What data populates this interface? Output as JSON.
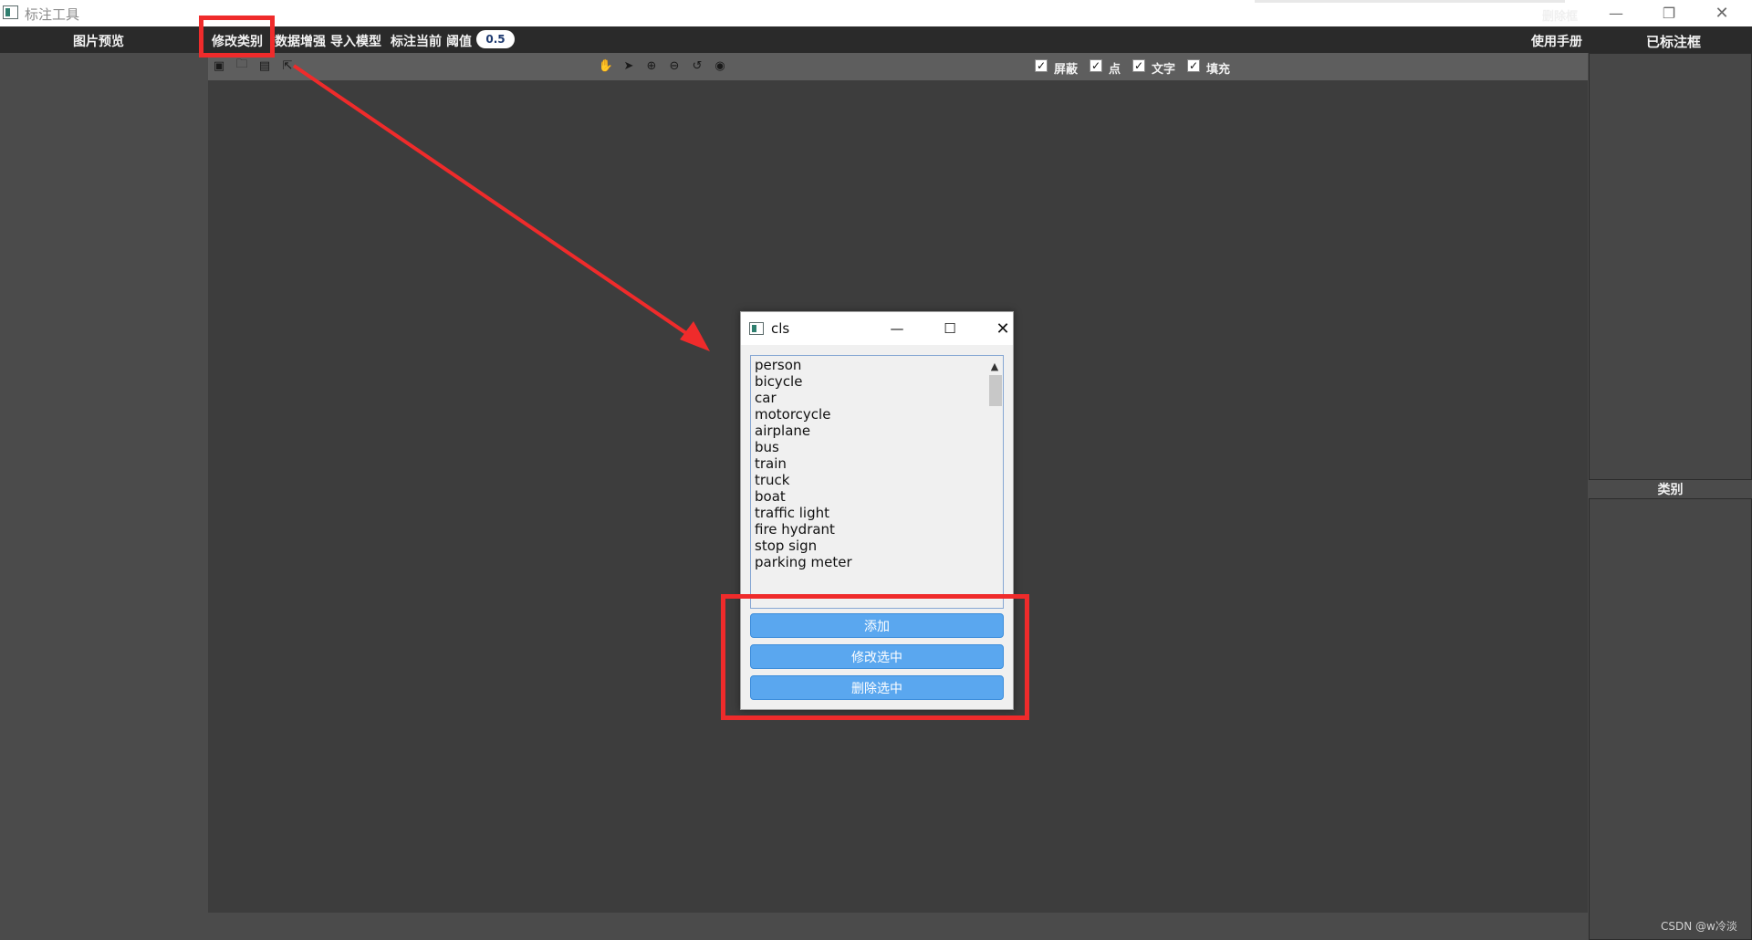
{
  "window": {
    "title": "标注工具",
    "controls": {
      "minimize": "—",
      "maximize": "❐",
      "close": "✕"
    }
  },
  "menubar": {
    "preview": "图片预览",
    "modify_class": "修改类别",
    "augment": "数据增强",
    "import_model": "导入模型",
    "annotate_current": "标注当前",
    "threshold_label": "阈值",
    "threshold_value": "0.5",
    "manual": "使用手册",
    "annotated_boxes": "已标注框"
  },
  "toolbar": {
    "left_icons": [
      "image-icon",
      "folder-icon",
      "save-icon",
      "export-icon"
    ],
    "center_icons": [
      "hand-icon",
      "pointer-icon",
      "zoom-in-icon",
      "zoom-out-icon",
      "undo-icon",
      "eye-icon"
    ],
    "checkboxes": [
      {
        "label": "屏蔽",
        "checked": true
      },
      {
        "label": "点",
        "checked": true
      },
      {
        "label": "文字",
        "checked": true
      },
      {
        "label": "填充",
        "checked": true
      }
    ],
    "delete_box": "删除框"
  },
  "right_panel": {
    "class_label": "类别"
  },
  "watermark": "CSDN @w冷淡",
  "dialog": {
    "title": "cls",
    "classes": [
      "person",
      "bicycle",
      "car",
      "motorcycle",
      "airplane",
      "bus",
      "train",
      "truck",
      "boat",
      "traffic light",
      "fire hydrant",
      "stop sign",
      "parking meter"
    ],
    "buttons": {
      "add": "添加",
      "modify": "修改选中",
      "delete": "删除选中"
    }
  },
  "colors": {
    "highlight": "#ef2b2b",
    "button": "#5aa7ef",
    "canvas": "#3d3d3d"
  }
}
